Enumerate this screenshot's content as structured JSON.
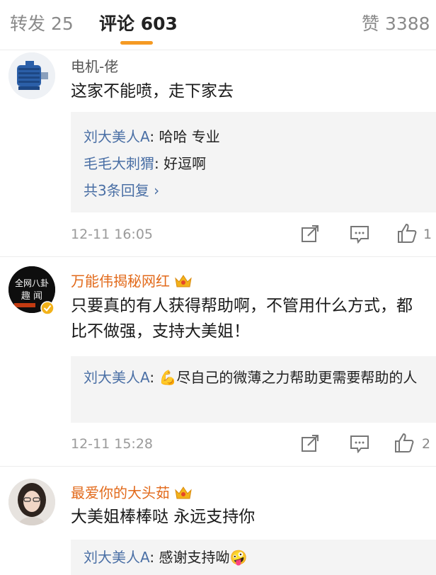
{
  "tabs": {
    "repost": "转发 25",
    "comments": "评论 603",
    "likes": "赞 3388",
    "accent": "#f59a23"
  },
  "comments": [
    {
      "user": "电机-佬",
      "text": "这家不能喷，走下家去",
      "replies": [
        {
          "name": "刘大美人A",
          "text": ": 哈哈  专业"
        },
        {
          "name": "毛毛大刺猬",
          "text": ": 好逗啊"
        }
      ],
      "more": "共3条回复 ›",
      "time": "12-11 16:05",
      "like_count": "1"
    },
    {
      "user": "万能伟揭秘网红",
      "avatar_text": "全网八卦 趣 闻",
      "text": "只要真的有人获得帮助啊，不管用什么方式，都比不做强，支持大美姐！",
      "replies": [
        {
          "name": "刘大美人A",
          "text": ": 💪尽自己的微薄之力帮助更需要帮助的人"
        }
      ],
      "time": "12-11 15:28",
      "like_count": "2"
    },
    {
      "user": "最爱你的大头茹",
      "text": "大美姐棒棒哒 永远支持你",
      "replies": [
        {
          "name": "刘大美人A",
          "text": ": 感谢支持呦🤪"
        }
      ]
    }
  ],
  "icons": {
    "repost": "share-icon",
    "comment": "comment-icon",
    "like": "thumbs-up-icon",
    "crown": "crown-icon"
  },
  "colors": {
    "username_vip": "#e26a1b",
    "reply_name": "#4a6fa5",
    "reply_bg": "#f4f4f4"
  }
}
